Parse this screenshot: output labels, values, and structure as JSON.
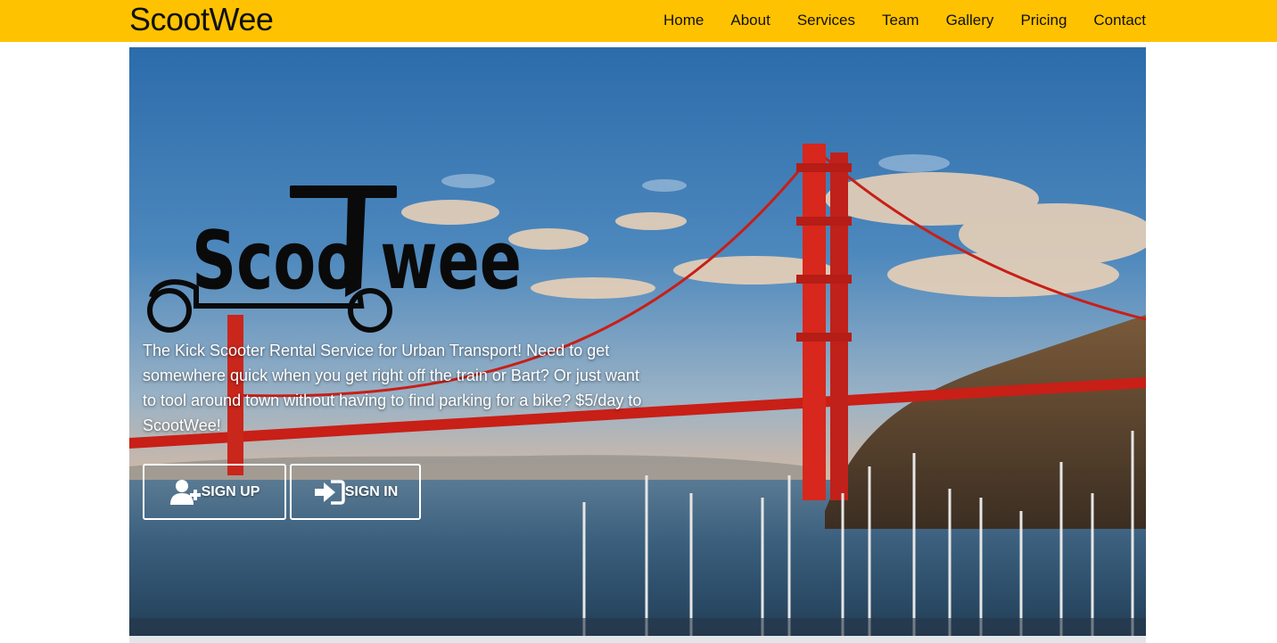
{
  "brand": "ScootWee",
  "nav": [
    "Home",
    "About",
    "Services",
    "Team",
    "Gallery",
    "Pricing",
    "Contact"
  ],
  "hero": {
    "logo_text": "ScootWee",
    "tagline": "The Kick Scooter Rental Service for Urban Transport! Need to get somewhere quick when you get right off the train or Bart? Or just want to tool around town without having to find parking for a bike? $5/day to ScootWee!",
    "signup_label": "SIGN UP",
    "signin_label": "SIGN IN",
    "signup_icon": "user-plus-icon",
    "signin_icon": "sign-in-icon"
  },
  "colors": {
    "navbar": "#FFC200",
    "bridge": "#d8271c",
    "sky_top": "#2f6fae",
    "water": "#2d4f6e"
  }
}
